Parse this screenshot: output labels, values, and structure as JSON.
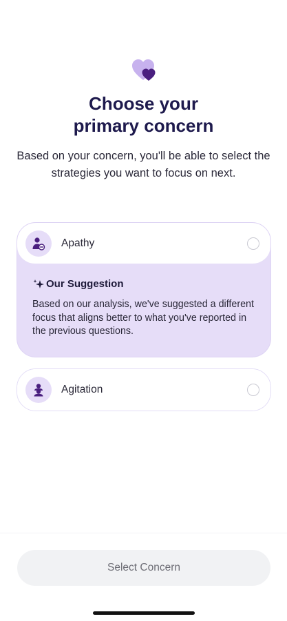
{
  "header": {
    "icon": "hearts-icon",
    "title": "Choose your\nprimary concern",
    "subtitle": "Based on your concern, you'll be able to select the strategies you want to focus on next."
  },
  "options": [
    {
      "label": "Apathy",
      "icon": "person-badge-icon",
      "selected": false,
      "suggestion": {
        "title": "Our Suggestion",
        "icon": "sparkle-icon",
        "text": "Based on our analysis, we've suggested a different focus that aligns better to what you've reported in the previous questions."
      }
    },
    {
      "label": "Agitation",
      "icon": "people-icon",
      "selected": false
    }
  ],
  "footer": {
    "button_label": "Select Concern"
  },
  "colors": {
    "accent": "#5b2d8e",
    "accent_light": "#e6ddf8",
    "title": "#1e1a4d"
  }
}
